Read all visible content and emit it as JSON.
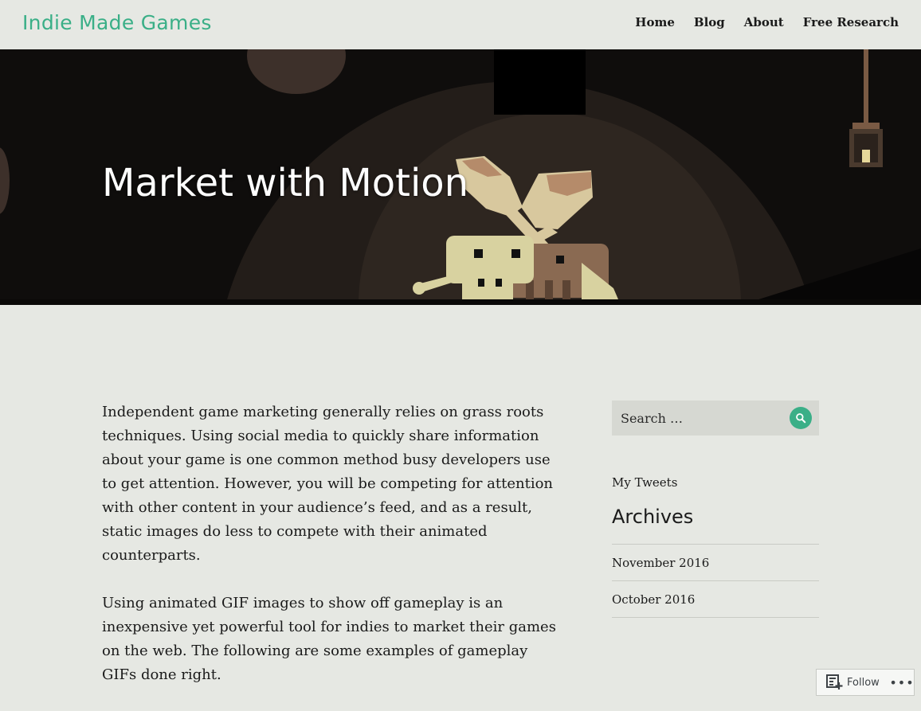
{
  "header": {
    "site_title": "Indie Made Games",
    "nav": [
      {
        "label": "Home"
      },
      {
        "label": "Blog"
      },
      {
        "label": "About"
      },
      {
        "label": "Free Research"
      }
    ]
  },
  "hero": {
    "title": "Market with Motion"
  },
  "article": {
    "paragraphs": [
      "Independent game marketing generally relies on grass roots techniques. Using social media to quickly share information about your game is one common method busy developers use to get attention. However, you will be competing for attention with other content in your audience’s feed, and as a result, static images do less to compete with their animated counterparts.",
      "Using animated GIF images to show off gameplay is an inexpensive yet powerful tool for indies to market their games on the web. The following are some examples of gameplay GIFs done right."
    ]
  },
  "sidebar": {
    "search_placeholder": "Search …",
    "my_tweets": "My Tweets",
    "archives_title": "Archives",
    "archives": [
      {
        "label": "November 2016"
      },
      {
        "label": "October 2016"
      }
    ]
  },
  "follow": {
    "label": "Follow",
    "more": "•••"
  },
  "colors": {
    "accent": "#3aaf87",
    "background": "#e6e8e3",
    "search_bg": "#d6d8d2"
  },
  "icons": {
    "search": "search-icon",
    "follow": "reader-follow-icon",
    "more": "ellipsis-icon"
  }
}
